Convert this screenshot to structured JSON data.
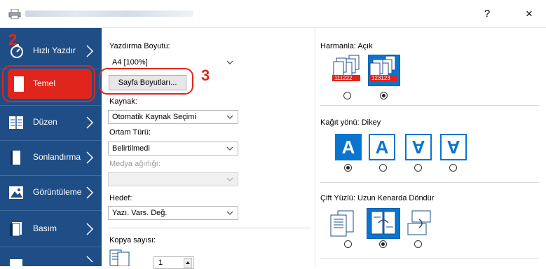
{
  "window": {
    "help_label": "?",
    "close_label": "×"
  },
  "sidebar": {
    "items": [
      {
        "label": "Hızlı Yazdır",
        "icon": "stopwatch-icon"
      },
      {
        "label": "Temel",
        "icon": "page-icon"
      },
      {
        "label": "Düzen",
        "icon": "layout-icon"
      },
      {
        "label": "Sonlandırma",
        "icon": "finishing-icon"
      },
      {
        "label": "Görüntüleme",
        "icon": "image-icon"
      },
      {
        "label": "Basım",
        "icon": "publishing-icon"
      }
    ],
    "selected_color": "#e0261c",
    "background_color": "#1f4e87"
  },
  "callouts": {
    "step2": "2",
    "step3": "3"
  },
  "basic": {
    "print_size_label": "Yazdırma Boyutu:",
    "print_size_value": "A4 [100%]",
    "page_sizes_button": "Sayfa Boyutları...",
    "source_label": "Kaynak:",
    "source_value": "Otomatik Kaynak Seçimi",
    "media_type_label": "Ortam Türü:",
    "media_type_value": "Belirtilmedi",
    "media_weight_label": "Medya ağırlığı:",
    "media_weight_value": "",
    "destination_label": "Hedef:",
    "destination_value": "Yazı. Vars. Değ.",
    "copies_label": "Kopya sayısı:",
    "copies_value": "1"
  },
  "right": {
    "collate_label": "Harmanla:",
    "collate_value": "Açık",
    "collate_badges": [
      "111222",
      "123123"
    ],
    "orientation_label": "Kağıt yönü:",
    "orientation_value": "Dikey",
    "orientation_glyphs": [
      "A",
      "A",
      "A",
      "A"
    ],
    "duplex_label": "Çift Yüzlü:",
    "duplex_value": "Uzun Kenarda Döndür",
    "accent_color": "#0a74d1"
  }
}
